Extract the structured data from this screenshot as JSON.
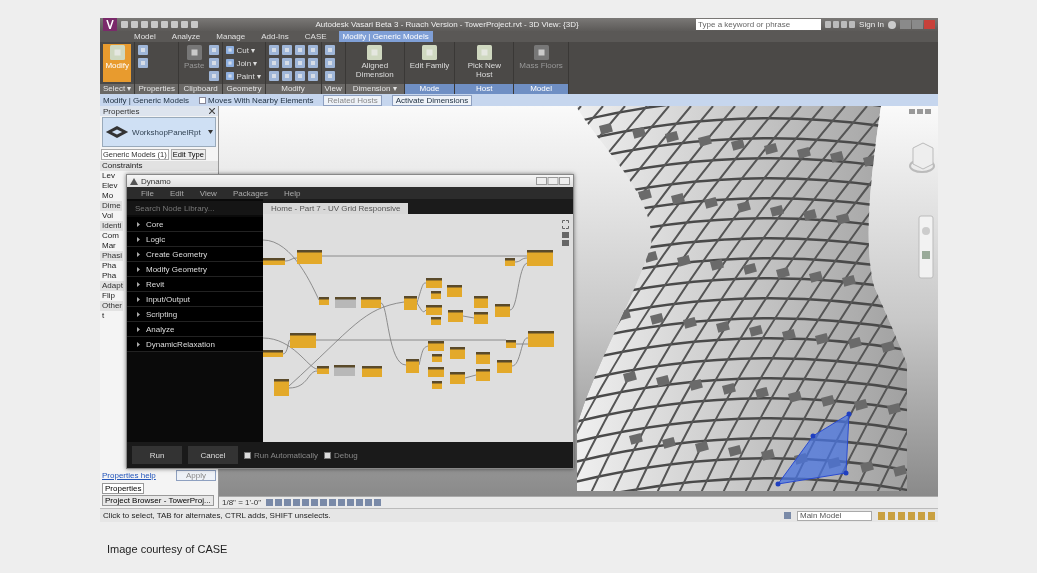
{
  "window": {
    "title": "Autodesk Vasari Beta 3 - Ruach Version - TowerProject.rvt - 3D View: {3D}",
    "search": {
      "placeholder": "Type a keyword or phrase"
    },
    "sign_in": "Sign In"
  },
  "ribbon_tabs": [
    {
      "label": "Model",
      "selected": false
    },
    {
      "label": "Analyze",
      "selected": false
    },
    {
      "label": "Manage",
      "selected": false
    },
    {
      "label": "Add-Ins",
      "selected": false
    },
    {
      "label": "CASE",
      "selected": false
    },
    {
      "label": "Modify | Generic Models",
      "selected": true
    }
  ],
  "ribbon_panels": [
    {
      "label": "Select ▾",
      "contextual": false,
      "tools": [
        {
          "kind": "large",
          "label": "Modify",
          "selected": true,
          "disabled": false
        }
      ]
    },
    {
      "label": "Properties",
      "contextual": false,
      "tools": [
        {
          "kind": "icon"
        },
        {
          "kind": "icon"
        }
      ]
    },
    {
      "label": "Clipboard",
      "contextual": false,
      "tools": [
        {
          "kind": "large",
          "label": "Paste",
          "selected": false,
          "disabled": true
        },
        {
          "kind": "icon"
        },
        {
          "kind": "icon"
        },
        {
          "kind": "icon"
        }
      ]
    },
    {
      "label": "Geometry",
      "contextual": false,
      "tools": [
        {
          "kind": "small",
          "label": "Cut ▾"
        },
        {
          "kind": "small",
          "label": "Join ▾"
        },
        {
          "kind": "small",
          "label": "Paint ▾"
        }
      ]
    },
    {
      "label": "Modify",
      "contextual": false,
      "tools": [
        {
          "kind": "icon"
        },
        {
          "kind": "icon"
        },
        {
          "kind": "icon"
        },
        {
          "kind": "icon"
        },
        {
          "kind": "icon"
        },
        {
          "kind": "icon"
        },
        {
          "kind": "icon"
        },
        {
          "kind": "icon"
        },
        {
          "kind": "icon"
        },
        {
          "kind": "icon"
        },
        {
          "kind": "icon"
        },
        {
          "kind": "icon"
        }
      ]
    },
    {
      "label": "View",
      "contextual": false,
      "tools": [
        {
          "kind": "icon"
        },
        {
          "kind": "icon"
        },
        {
          "kind": "icon"
        }
      ]
    },
    {
      "label": "Dimension ▾",
      "contextual": false,
      "tools": [
        {
          "kind": "large",
          "label": "Aligned Dimension",
          "selected": false,
          "disabled": false
        }
      ]
    },
    {
      "label": "Mode",
      "contextual": true,
      "tools": [
        {
          "kind": "large",
          "label": "Edit Family",
          "selected": false,
          "disabled": false
        }
      ]
    },
    {
      "label": "Host",
      "contextual": true,
      "tools": [
        {
          "kind": "large",
          "label": "Pick New Host",
          "selected": false,
          "disabled": false
        }
      ]
    },
    {
      "label": "Model",
      "contextual": true,
      "tools": [
        {
          "kind": "large",
          "label": "Mass Floors",
          "selected": false,
          "disabled": true
        }
      ]
    }
  ],
  "options_bar": {
    "context": "Modify | Generic Models",
    "moves_with_nearby": {
      "label": "Moves With Nearby Elements",
      "checked": false
    },
    "related_hosts": {
      "label": "Related Hosts",
      "disabled": true
    },
    "activate_dimensions": "Activate Dimensions"
  },
  "properties": {
    "title": "Properties",
    "type_name": "WorkshopPanelRpt",
    "instance_filter": "Generic Models (1)",
    "edit_type": "Edit Type",
    "first_group": "Constraints",
    "rows": [
      {
        "kind": "param",
        "label": "Lev"
      },
      {
        "kind": "param",
        "label": "Elev"
      },
      {
        "kind": "param",
        "label": "Mo"
      },
      {
        "kind": "group",
        "label": "Dime"
      },
      {
        "kind": "param",
        "label": "Vol"
      },
      {
        "kind": "group",
        "label": "Identi"
      },
      {
        "kind": "param",
        "label": "Com"
      },
      {
        "kind": "param",
        "label": "Mar"
      },
      {
        "kind": "group",
        "label": "Phasi"
      },
      {
        "kind": "param",
        "label": "Pha"
      },
      {
        "kind": "param",
        "label": "Pha"
      },
      {
        "kind": "group",
        "label": "Adapt"
      },
      {
        "kind": "param",
        "label": "Flip"
      },
      {
        "kind": "group",
        "label": "Other"
      },
      {
        "kind": "param",
        "label": "t"
      }
    ],
    "help_link": "Properties help",
    "apply": "Apply",
    "tabs": [
      {
        "label": "Properties",
        "selected": true
      },
      {
        "label": "Project Browser - TowerProj...",
        "selected": false
      }
    ]
  },
  "dynamo": {
    "title": "Dynamo",
    "menu": [
      "File",
      "Edit",
      "View",
      "Packages",
      "Help"
    ],
    "search": {
      "placeholder": "Search Node Library..."
    },
    "categories": [
      "Core",
      "Logic",
      "Create Geometry",
      "Modify Geometry",
      "Revit",
      "Input/Output",
      "Scripting",
      "Analyze",
      "DynamicRelaxation"
    ],
    "workspace_tab": "Home - Part 7 - UV Grid Responsive",
    "run": "Run",
    "cancel": "Cancel",
    "options": [
      {
        "label": "Run Automatically",
        "checked": false
      },
      {
        "label": "Debug",
        "checked": false
      }
    ]
  },
  "view_control": {
    "scale": "1/8\" = 1'-0\""
  },
  "status_bar": {
    "message": "Click to select, TAB for alternates, CTRL adds, SHIFT unselects.",
    "workset": "Main Model"
  },
  "caption": "Image courtesy of CASE"
}
